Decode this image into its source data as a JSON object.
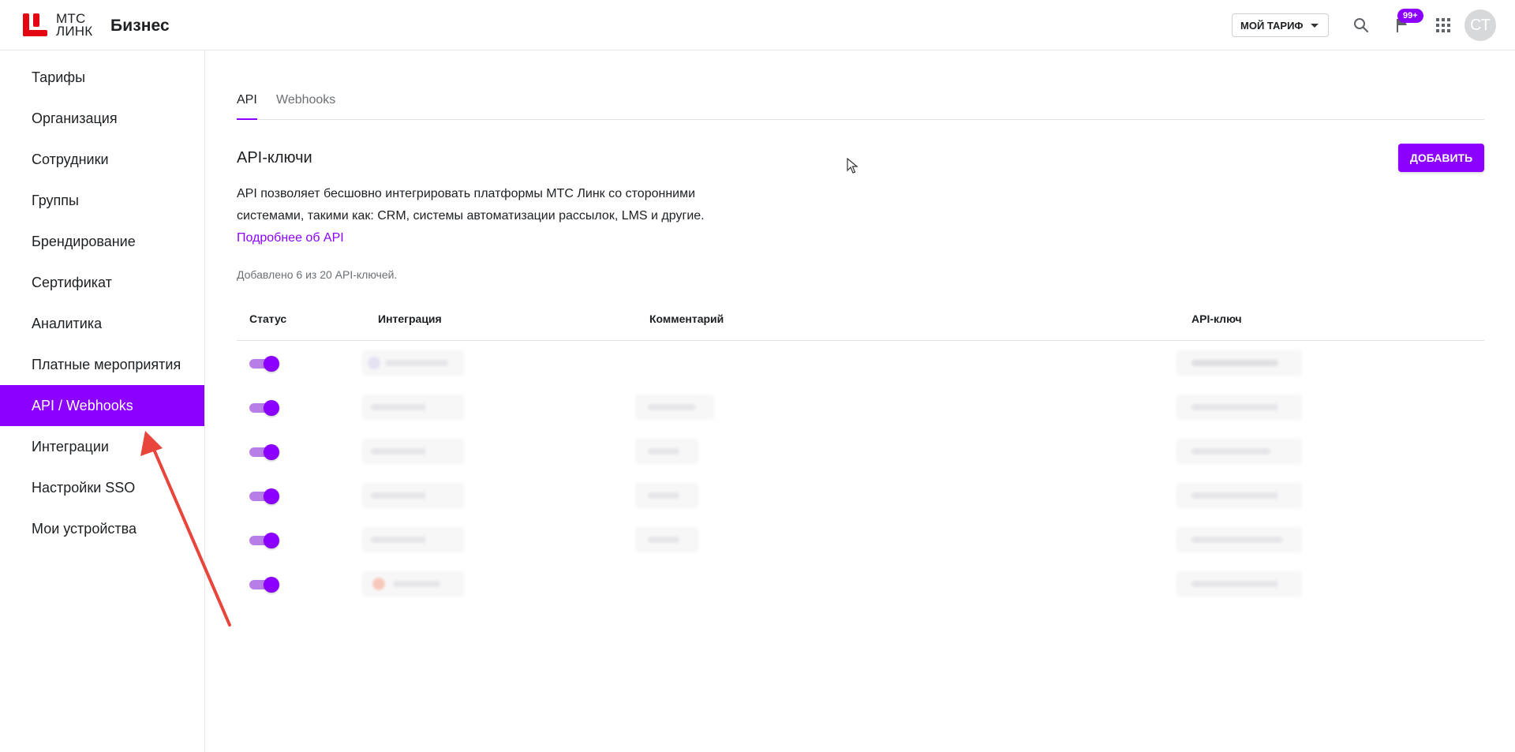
{
  "header": {
    "logo_text_line1": "МТС",
    "logo_text_line2": "ЛИНК",
    "brand": "Бизнес",
    "tariff_button": "МОЙ ТАРИФ",
    "notifications_badge": "99+",
    "avatar_initials": "СТ",
    "icons": {
      "search": "search-icon",
      "notifications": "flag-icon",
      "apps": "apps-grid-icon"
    }
  },
  "sidebar": {
    "items": [
      {
        "label": "Тарифы",
        "active": false
      },
      {
        "label": "Организация",
        "active": false
      },
      {
        "label": "Сотрудники",
        "active": false
      },
      {
        "label": "Группы",
        "active": false
      },
      {
        "label": "Брендирование",
        "active": false
      },
      {
        "label": "Сертификат",
        "active": false
      },
      {
        "label": "Аналитика",
        "active": false
      },
      {
        "label": "Платные мероприятия",
        "active": false
      },
      {
        "label": "API / Webhooks",
        "active": true
      },
      {
        "label": "Интеграции",
        "active": false
      },
      {
        "label": "Настройки SSO",
        "active": false
      },
      {
        "label": "Мои устройства",
        "active": false
      }
    ]
  },
  "tabs": [
    {
      "label": "API",
      "active": true
    },
    {
      "label": "Webhooks",
      "active": false
    }
  ],
  "main": {
    "title": "API-ключи",
    "add_button": "ДОБАВИТЬ",
    "description_line1": "API позволяет бесшовно интегрировать платформы МТС Линк со сторонними",
    "description_line2": "системами, такими как: CRM, системы автоматизации рассылок, LMS и другие.",
    "more_link": "Подробнее об API",
    "count_text": "Добавлено 6 из 20 API-ключей."
  },
  "table": {
    "columns": [
      "Статус",
      "Интеграция",
      "Комментарий",
      "API-ключ"
    ],
    "rows": [
      {
        "enabled": true
      },
      {
        "enabled": true
      },
      {
        "enabled": true
      },
      {
        "enabled": true
      },
      {
        "enabled": true
      },
      {
        "enabled": true
      }
    ]
  },
  "colors": {
    "accent": "#8b00ff",
    "toggle_track": "#b87ee8",
    "annotation_arrow": "#e8453c",
    "logo_red": "#e30611"
  }
}
